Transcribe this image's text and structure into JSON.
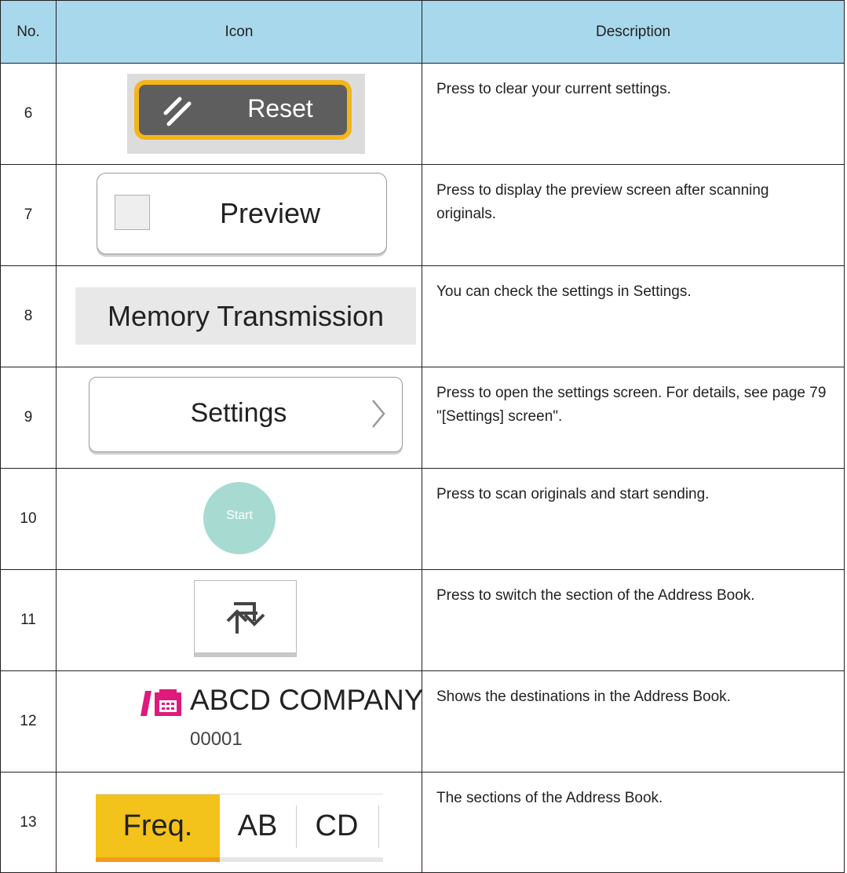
{
  "header": {
    "no": "No.",
    "icon": "Icon",
    "description": "Description"
  },
  "rows": [
    {
      "no": "6",
      "icon_label": "Reset",
      "icon_name": "reset-icon",
      "description": "Press to clear your current settings."
    },
    {
      "no": "7",
      "icon_label": "Preview",
      "icon_name": "checkbox-icon",
      "description": "Press to display the preview screen after scanning originals."
    },
    {
      "no": "8",
      "icon_label": "Memory Transmission",
      "description": "You can check the settings in Settings."
    },
    {
      "no": "9",
      "icon_label": "Settings",
      "icon_name": "chevron-right-icon",
      "description": "Press to open the settings screen. For details, see page 79 \"[Settings] screen\"."
    },
    {
      "no": "10",
      "icon_label": "Start",
      "description": "Press to scan originals and start sending."
    },
    {
      "no": "11",
      "icon_name": "switch-arrows-icon",
      "description": "Press to switch the section of the Address Book."
    },
    {
      "no": "12",
      "icon_name": "fax-icon",
      "destination_name": "ABCD COMPANY",
      "destination_number": "00001",
      "description": "Shows the destinations in the Address Book."
    },
    {
      "no": "13",
      "tabs": [
        "Freq.",
        "AB",
        "CD"
      ],
      "description": "The sections of the Address Book."
    }
  ],
  "colors": {
    "header_bg": "#a8d8ec",
    "reset_border": "#f3b51c",
    "reset_bg": "#5e5e5e",
    "start_bg": "#a7dbd2",
    "fax_icon": "#e0197d",
    "tab_active": "#f3c21b",
    "tab_underline": "#f39b1e"
  }
}
